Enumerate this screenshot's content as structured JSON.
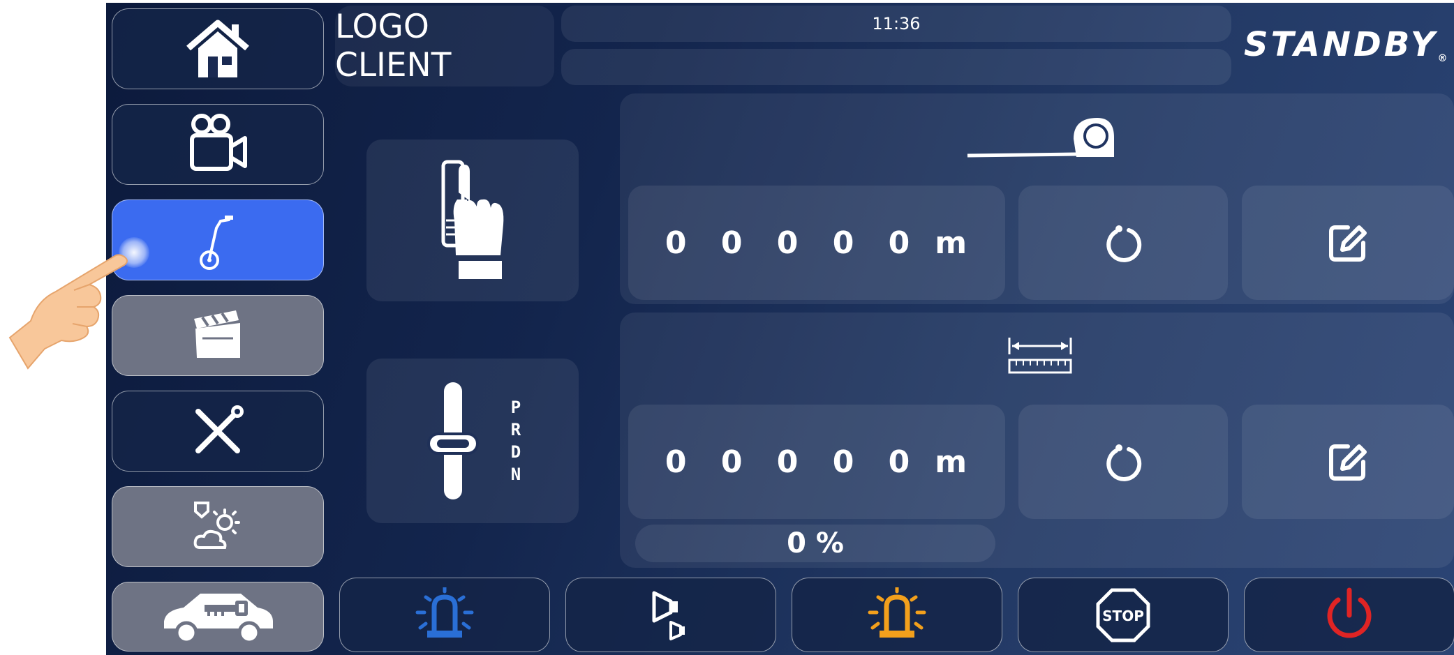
{
  "header": {
    "time": "11:36",
    "client_logo": "LOGO CLIENT",
    "brand": "STANDBY",
    "brand_mark": "®"
  },
  "sidebar": {
    "items": [
      {
        "id": "home",
        "icon": "home-icon"
      },
      {
        "id": "camera",
        "icon": "video-camera-icon"
      },
      {
        "id": "measuring-wheel",
        "icon": "measuring-wheel-icon",
        "active": true
      },
      {
        "id": "clapperboard",
        "icon": "clapperboard-icon"
      },
      {
        "id": "tools",
        "icon": "tools-icon"
      },
      {
        "id": "weather",
        "icon": "weather-icon"
      },
      {
        "id": "car-key",
        "icon": "car-key-icon"
      }
    ]
  },
  "controls": {
    "left_tiles": [
      {
        "id": "hand-control",
        "icon": "hand-lever-icon"
      },
      {
        "id": "gear-shift",
        "icon": "gear-shifter-icon",
        "gears": [
          "P",
          "R",
          "D",
          "N"
        ]
      }
    ]
  },
  "distance": {
    "icon": "tape-measure-icon",
    "value": "0 0 0 0 0",
    "unit": "m",
    "reset_icon": "reset-icon",
    "edit_icon": "edit-icon"
  },
  "width": {
    "icon": "ruler-width-icon",
    "value": "0 0 0 0 0",
    "unit": "m",
    "reset_icon": "reset-icon",
    "edit_icon": "edit-icon",
    "percent": "0 %"
  },
  "bottom_bar": [
    {
      "id": "blue-beacon",
      "icon": "beacon-icon",
      "color": "#2a6fd6"
    },
    {
      "id": "horn",
      "icon": "horn-icon"
    },
    {
      "id": "orange-beacon",
      "icon": "beacon-icon",
      "color": "#f3a01c"
    },
    {
      "id": "stop",
      "icon": "stop-sign-icon",
      "label": "STOP"
    },
    {
      "id": "power",
      "icon": "power-icon",
      "color": "#e02424"
    }
  ],
  "colors": {
    "active": "#3b6bf0",
    "blue_beacon": "#2a6fd6",
    "orange_beacon": "#f3a01c",
    "power": "#e02424"
  }
}
